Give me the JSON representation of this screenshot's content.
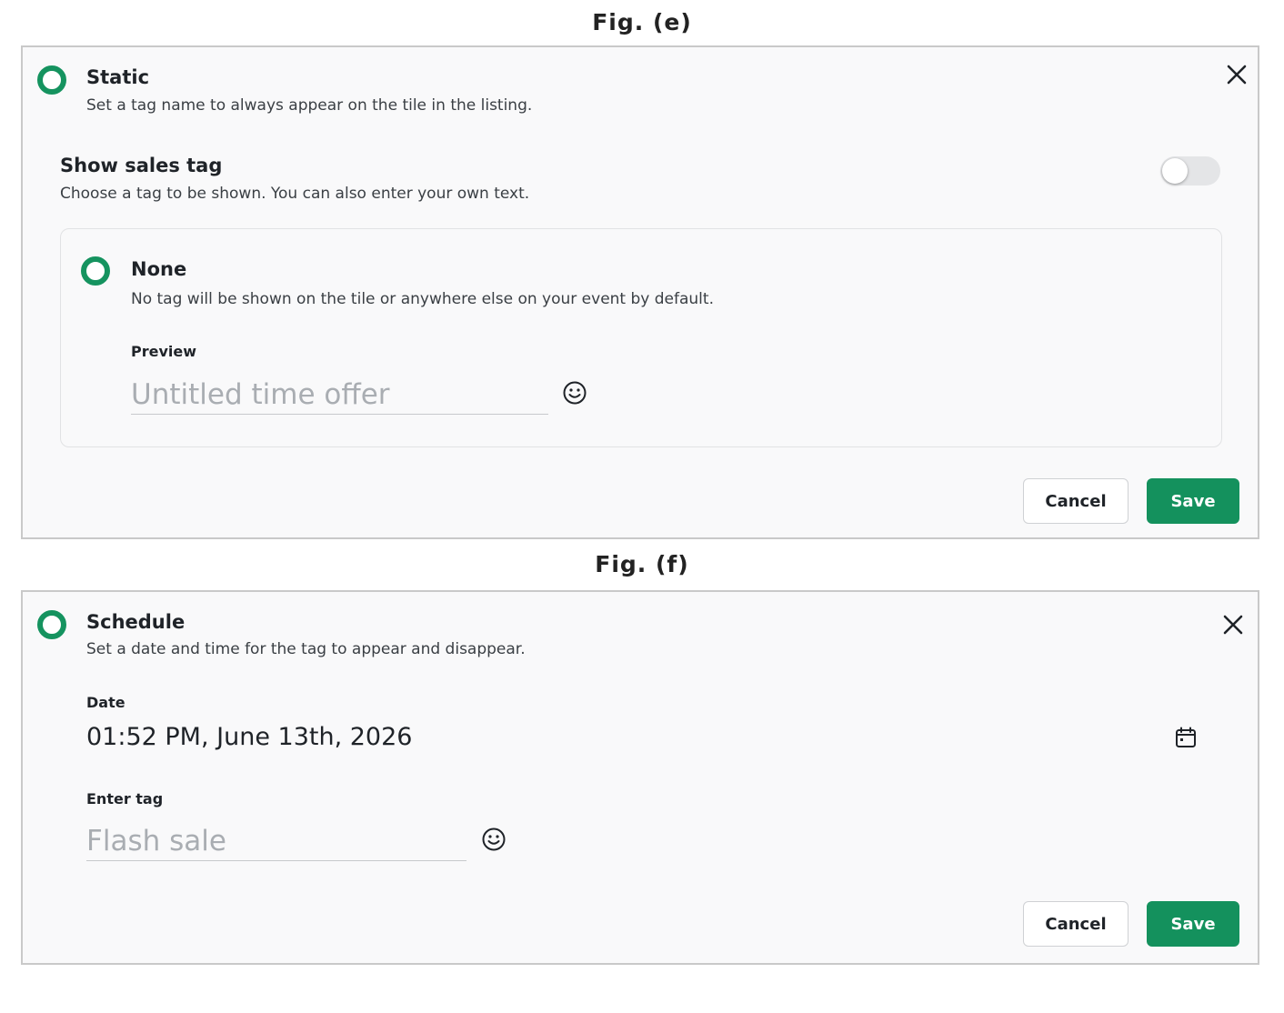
{
  "fig_e": {
    "caption": "Fig. (e)",
    "option_title": "Static",
    "option_desc": "Set a tag name to always appear on the tile in the listing.",
    "sales_tag_title": "Show sales tag",
    "sales_tag_desc": "Choose a tag to be shown. You can also enter your own text.",
    "toggle_on": false,
    "none_title": "None",
    "none_desc": "No tag will be shown on the tile or anywhere else on your event by default.",
    "preview_label": "Preview",
    "preview_placeholder": "Untitled time offer",
    "cancel_label": "Cancel",
    "save_label": "Save"
  },
  "fig_f": {
    "caption": "Fig. (f)",
    "option_title": "Schedule",
    "option_desc": "Set a date and time for the tag to appear and disappear.",
    "date_label": "Date",
    "date_value": "01:52 PM, June 13th, 2026",
    "tag_label": "Enter tag",
    "tag_placeholder": "Flash sale",
    "cancel_label": "Cancel",
    "save_label": "Save"
  },
  "icons": {
    "radio": "radio-selected-icon",
    "close": "close-icon",
    "emoji": "smiley-icon",
    "calendar": "calendar-icon"
  },
  "colors": {
    "accent": "#15935f",
    "save_button": "#14915d",
    "panel_bg": "#f9f9fa",
    "toggle_off": "#e4e5e7"
  }
}
